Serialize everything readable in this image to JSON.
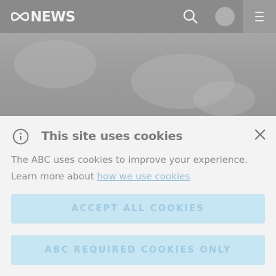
{
  "header": {
    "brand": "NEWS",
    "logo_icon": "abc-lissajous-logo",
    "search_icon": "search-icon",
    "account_icon": "avatar",
    "menu_icon": "hamburger-menu-icon"
  },
  "cookie_banner": {
    "title": "This site uses cookies",
    "info_icon": "info-icon",
    "close_icon": "close-icon",
    "body_line1": "The ABC uses cookies to improve your experience.",
    "body_line2_prefix": "Learn more about ",
    "body_link": "how we use cookies",
    "accept_all_label": "ACCEPT ALL COOKIES",
    "required_only_label": "ABC REQUIRED COOKIES ONLY"
  },
  "colors": {
    "button_bg": "#c6e6f3",
    "button_text": "#9ecbe0",
    "link": "#8fc0dc"
  }
}
